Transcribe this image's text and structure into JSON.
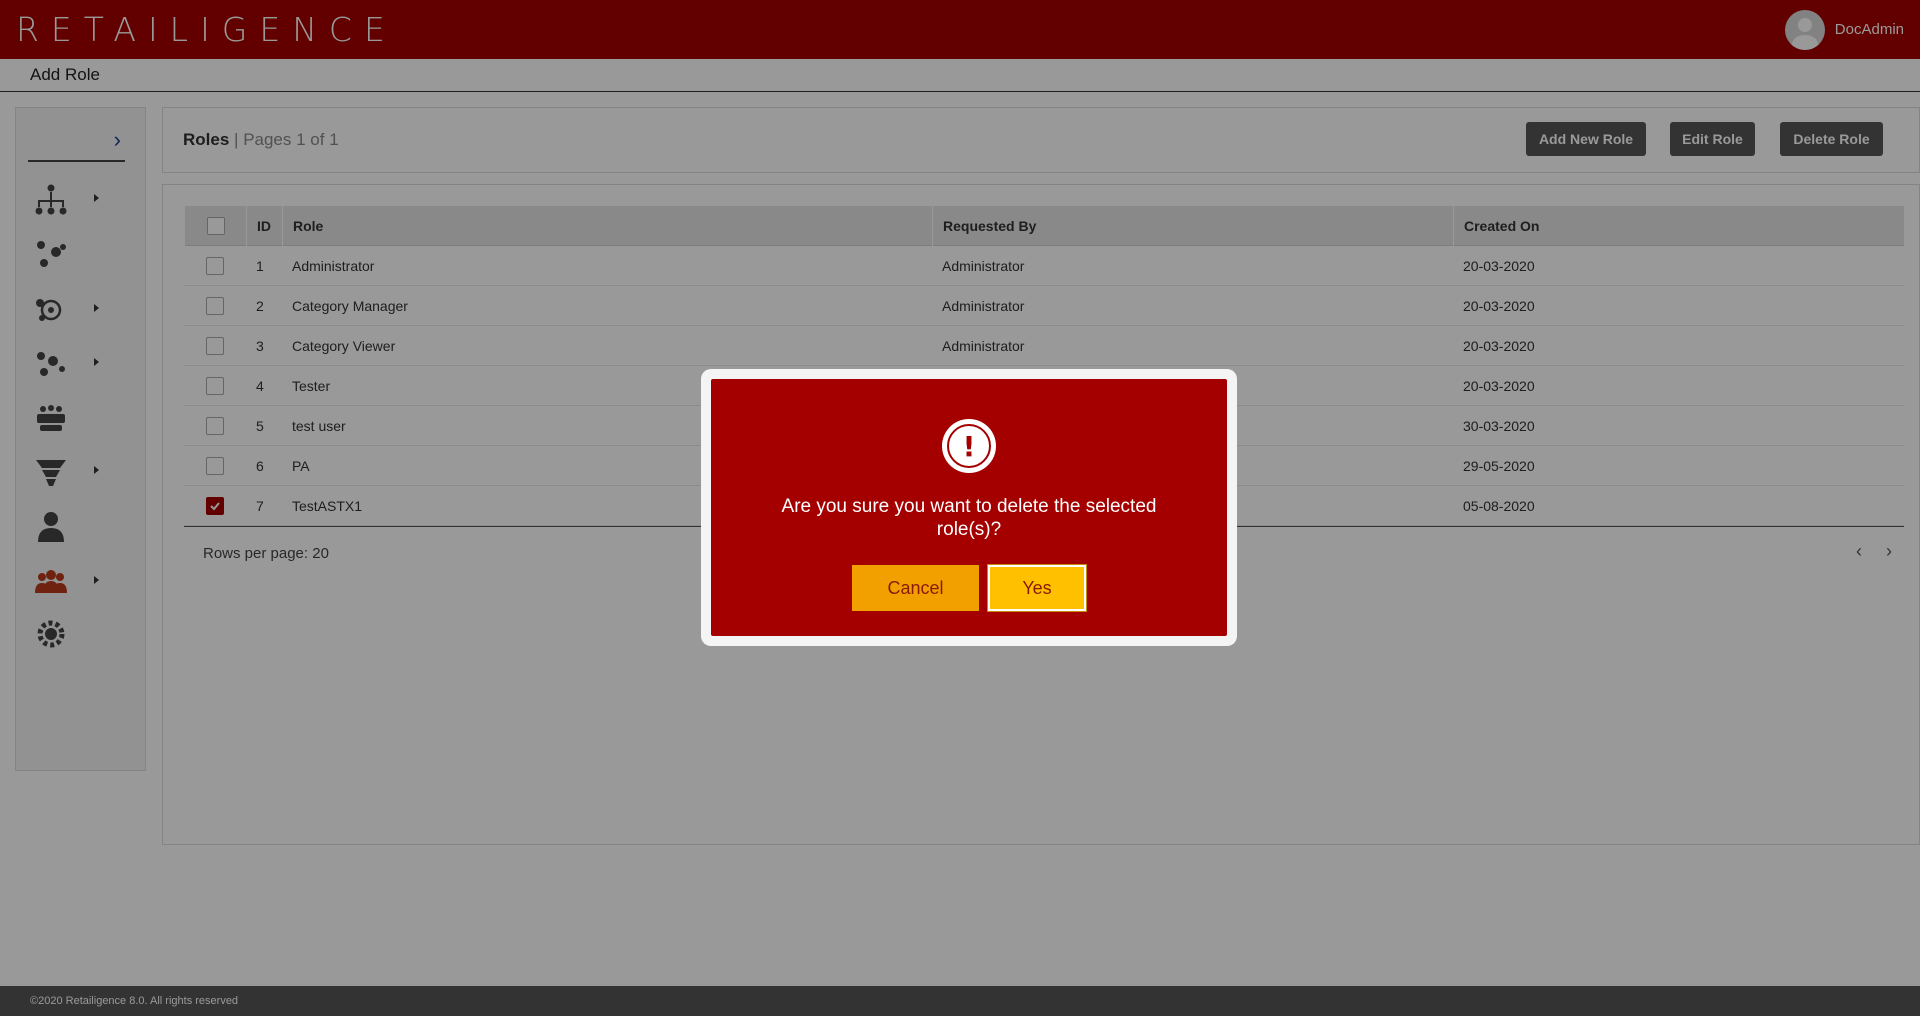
{
  "header": {
    "logo": "RETAILIGENCE",
    "user_name": "DocAdmin"
  },
  "subheader": {
    "title": "Add Role"
  },
  "toolbar": {
    "title": "Roles",
    "separator": "|",
    "pages": "Pages 1 of 1",
    "buttons": {
      "add": "Add New Role",
      "edit": "Edit Role",
      "delete": "Delete Role"
    }
  },
  "table": {
    "columns": {
      "id": "ID",
      "role": "Role",
      "requested_by": "Requested By",
      "created_on": "Created On"
    },
    "rows": [
      {
        "id": "1",
        "role": "Administrator",
        "requested_by": "Administrator",
        "created_on": "20-03-2020",
        "checked": false
      },
      {
        "id": "2",
        "role": "Category Manager",
        "requested_by": "Administrator",
        "created_on": "20-03-2020",
        "checked": false
      },
      {
        "id": "3",
        "role": "Category Viewer",
        "requested_by": "Administrator",
        "created_on": "20-03-2020",
        "checked": false
      },
      {
        "id": "4",
        "role": "Tester",
        "requested_by": "",
        "created_on": "20-03-2020",
        "checked": false
      },
      {
        "id": "5",
        "role": "test user",
        "requested_by": "",
        "created_on": "30-03-2020",
        "checked": false
      },
      {
        "id": "6",
        "role": "PA",
        "requested_by": "",
        "created_on": "29-05-2020",
        "checked": false
      },
      {
        "id": "7",
        "role": "TestASTX1",
        "requested_by": "",
        "created_on": "05-08-2020",
        "checked": true
      }
    ],
    "rows_per_page": "Rows per page: 20"
  },
  "footer": {
    "text": "©2020 Retailigence 8.0. All rights reserved"
  },
  "dialog": {
    "icon": "warning-icon",
    "message": "Are you sure you want to delete the selected role(s)?",
    "cancel": "Cancel",
    "yes": "Yes"
  },
  "colors": {
    "brand": "#a40000",
    "cancel": "#f1a000",
    "yes": "#ffc000",
    "toolbar_button": "#555555"
  }
}
